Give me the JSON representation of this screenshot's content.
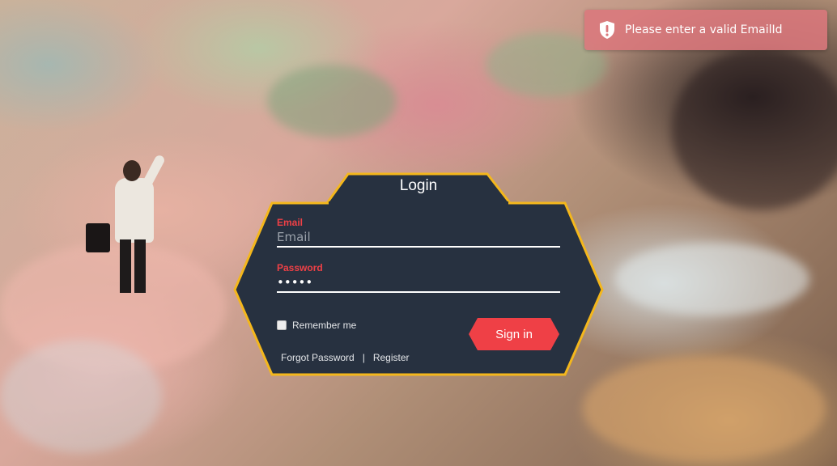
{
  "toast": {
    "message": "Please enter a valid EmailId",
    "icon": "shield-alert-icon",
    "color": "#db787c"
  },
  "login": {
    "title": "Login",
    "email_label": "Email",
    "email_placeholder": "Email",
    "email_value": "",
    "password_label": "Password",
    "password_value": "•••••",
    "remember_label": "Remember me",
    "remember_checked": false,
    "signin_label": "Sign in",
    "forgot_label": "Forgot Password",
    "separator": "|",
    "register_label": "Register"
  },
  "colors": {
    "panel": "#273140",
    "border": "#f4b71c",
    "accent": "#ef4046"
  }
}
